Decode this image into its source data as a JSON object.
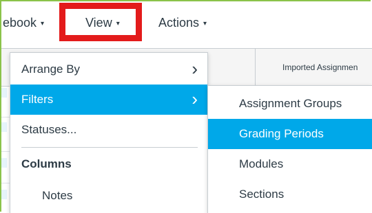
{
  "menubar": {
    "tabs": [
      {
        "label": "ebook",
        "has_caret": true
      },
      {
        "label": "View",
        "has_caret": true
      },
      {
        "label": "Actions",
        "has_caret": true
      }
    ],
    "caret_glyph": "▾"
  },
  "grid": {
    "column_header": "Imported Assignmen"
  },
  "view_menu": {
    "items": [
      {
        "label": "Arrange By"
      },
      {
        "label": "Filters"
      },
      {
        "label": "Statuses..."
      },
      {
        "label": "Columns"
      },
      {
        "label": "Notes"
      }
    ],
    "chevron_glyph": "›"
  },
  "filters_submenu": {
    "items": [
      {
        "label": "Assignment Groups"
      },
      {
        "label": "Grading Periods"
      },
      {
        "label": "Modules"
      },
      {
        "label": "Sections"
      }
    ]
  },
  "colors": {
    "accent_green": "#8bc34a",
    "highlight_red": "#e31b1b",
    "active_blue": "#00a8e9",
    "text": "#2d3b45"
  }
}
